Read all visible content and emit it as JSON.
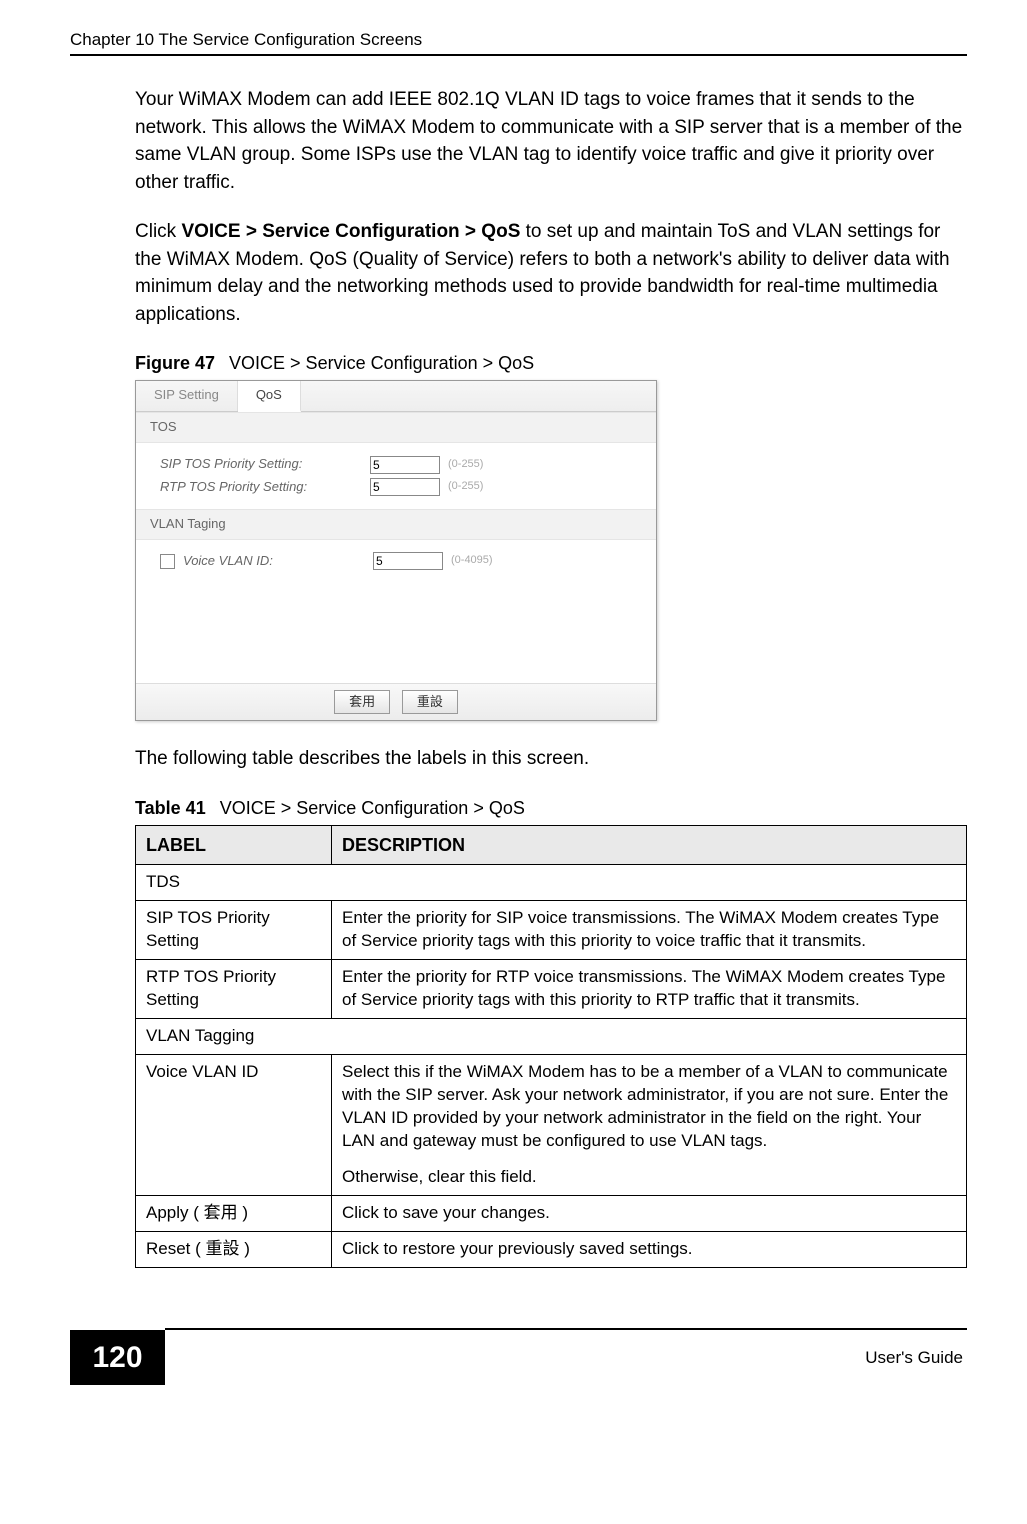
{
  "header": {
    "chapter": "Chapter 10 The Service Configuration Screens"
  },
  "paragraphs": {
    "p1": "Your WiMAX Modem can add IEEE 802.1Q VLAN ID tags to voice frames that it sends to the network. This allows the WiMAX Modem to communicate with a SIP server that is a member of the same VLAN group. Some ISPs use the VLAN tag to identify voice traffic and give it priority over other traffic.",
    "p2_pre": "Click ",
    "p2_bold": "VOICE > Service Configuration > QoS",
    "p2_post": " to set up and maintain ToS and VLAN settings for the WiMAX Modem. QoS (Quality of Service) refers to both a network's ability to deliver data with minimum delay and the networking methods used to provide bandwidth for real-time multimedia applications.",
    "p3": "The following table describes the labels in this screen."
  },
  "figure": {
    "label": "Figure 47",
    "caption": "VOICE > Service Configuration > QoS"
  },
  "screenshot": {
    "tabs": {
      "sip": "SIP Setting",
      "qos": "QoS"
    },
    "sections": {
      "tos": "TOS",
      "vlan": "VLAN Taging"
    },
    "rows": {
      "sip_label": "SIP TOS Priority Setting:",
      "sip_value": "5",
      "sip_hint": "(0-255)",
      "rtp_label": "RTP TOS Priority Setting:",
      "rtp_value": "5",
      "rtp_hint": "(0-255)",
      "vlan_label": "Voice VLAN ID:",
      "vlan_value": "5",
      "vlan_hint": "(0-4095)"
    },
    "buttons": {
      "apply": "套用",
      "reset": "重設"
    }
  },
  "table": {
    "label": "Table 41",
    "caption": "VOICE > Service Configuration > QoS",
    "headers": {
      "c1": "LABEL",
      "c2": "DESCRIPTION"
    },
    "rows": {
      "r1c1": "TDS",
      "r2c1": "SIP TOS Priority Setting",
      "r2c2": "Enter the priority for SIP voice transmissions. The WiMAX Modem creates Type of Service priority tags with this priority to voice traffic that it transmits.",
      "r3c1": "RTP TOS Priority Setting",
      "r3c2": "Enter the priority for RTP voice transmissions. The WiMAX Modem creates Type of Service priority tags with this priority to RTP traffic that it transmits.",
      "r4c1": "VLAN Tagging",
      "r5c1": "Voice VLAN ID",
      "r5c2a": "Select this if the WiMAX Modem has to be a member of a VLAN to communicate with the SIP server. Ask your network administrator, if you are not sure. Enter the VLAN ID provided by your network administrator in the field on the right. Your LAN and gateway must be configured to use VLAN tags.",
      "r5c2b": "Otherwise, clear this field.",
      "r6c1": "Apply ( 套用 )",
      "r6c2": "Click to save your changes.",
      "r7c1": "Reset ( 重設 )",
      "r7c2": "Click to restore your previously saved settings."
    }
  },
  "footer": {
    "page": "120",
    "guide": "User's Guide"
  }
}
